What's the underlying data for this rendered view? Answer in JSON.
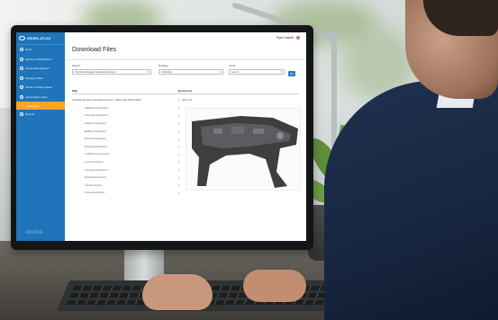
{
  "app": {
    "brand": "ARORA ATLAS",
    "sidebar_watermark": "ARORA",
    "user_name": "Ryan Gaskell",
    "accent_color": "#1f74ba",
    "highlight_color": "#f5a623"
  },
  "sidebar": {
    "items": [
      {
        "label": "Home",
        "icon": "home-icon"
      },
      {
        "label": "Activity & Workstations",
        "icon": "activity-icon"
      },
      {
        "label": "Access Management",
        "icon": "access-icon"
      },
      {
        "label": "Manage Station",
        "icon": "station-icon"
      },
      {
        "label": "Vendor Tracking Assets",
        "icon": "vendor-icon"
      },
      {
        "label": "Vacant Space Files",
        "icon": "files-icon"
      }
    ],
    "active_sub": "Download",
    "after_items": [
      {
        "label": "Reports",
        "icon": "reports-icon"
      }
    ]
  },
  "page": {
    "title": "Download Files"
  },
  "filters": {
    "airport_label": "Airport",
    "airport_value": "Charlotte Douglas International Airport",
    "building_label": "Building",
    "building_value": "A Building",
    "level_label": "Level",
    "level_value": "Level 1",
    "go_label": "Go"
  },
  "table": {
    "col_map": "Map",
    "col_download": "Download",
    "first_row_label": "Charlotte Douglas International Airport - [VEHICLE] ADVIS MDA",
    "first_row_download": "DWG File",
    "rows": [
      "Additional Zone/priors",
      "Assembly Zone/priors",
      "Aviation Zone/priors",
      "Building Zone/priors",
      "Fixtures Zone/priors",
      "Footprint Zone/priors",
      "Landforms Zone/priors",
      "Level Zone/priors",
      "Occupant Zone/priors",
      "Opening Zone/priors",
      "Unit Zone/priors",
      "Venue Zone/priors"
    ]
  }
}
